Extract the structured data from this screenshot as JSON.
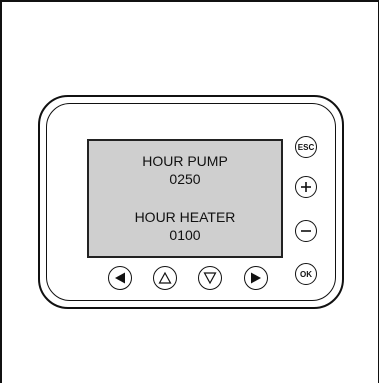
{
  "display": {
    "line1": "HOUR PUMP",
    "line2": "0250",
    "line3": "HOUR HEATER",
    "line4": "0100"
  },
  "buttons": {
    "esc_label": "ESC",
    "ok_label": "OK",
    "plus_icon": "plus-icon",
    "minus_icon": "minus-icon",
    "left_icon": "left-arrow-icon",
    "up_icon": "up-arrow-icon",
    "down_icon": "down-arrow-icon",
    "right_icon": "right-arrow-icon"
  }
}
